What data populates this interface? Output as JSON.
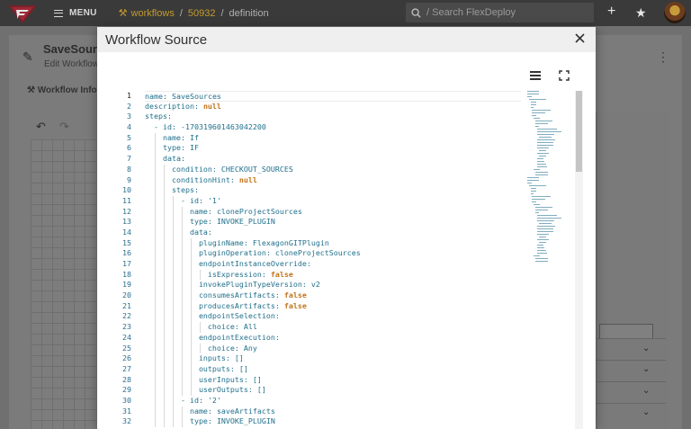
{
  "topbar": {
    "menu_label": "MENU",
    "breadcrumb": [
      "workflows",
      "50932",
      "definition"
    ],
    "breadcrumb_sep": "/",
    "search_placeholder": "/ Search FlexDeploy"
  },
  "background": {
    "title": "SaveSourc",
    "subtitle": "Edit Workflow",
    "tab": "Workflow Info"
  },
  "modal": {
    "title": "Workflow Source",
    "code_lines": [
      [
        [
          "k",
          "name: "
        ],
        [
          "v",
          "SaveSources"
        ]
      ],
      [
        [
          "k",
          "description: "
        ],
        [
          "kw",
          "null"
        ]
      ],
      [
        [
          "k",
          "steps:"
        ]
      ],
      [
        [
          "k",
          "  - id: "
        ],
        [
          "v",
          "-170319601463042200"
        ]
      ],
      [
        [
          "k",
          "    name: "
        ],
        [
          "v",
          "If"
        ]
      ],
      [
        [
          "k",
          "    type: "
        ],
        [
          "v",
          "IF"
        ]
      ],
      [
        [
          "k",
          "    data:"
        ]
      ],
      [
        [
          "k",
          "      condition: "
        ],
        [
          "v",
          "CHECKOUT_SOURCES"
        ]
      ],
      [
        [
          "k",
          "      conditionHint: "
        ],
        [
          "kw",
          "null"
        ]
      ],
      [
        [
          "k",
          "      steps:"
        ]
      ],
      [
        [
          "k",
          "        - id: "
        ],
        [
          "s",
          "'1'"
        ]
      ],
      [
        [
          "k",
          "          name: "
        ],
        [
          "v",
          "cloneProjectSources"
        ]
      ],
      [
        [
          "k",
          "          type: "
        ],
        [
          "v",
          "INVOKE_PLUGIN"
        ]
      ],
      [
        [
          "k",
          "          data:"
        ]
      ],
      [
        [
          "k",
          "            pluginName: "
        ],
        [
          "v",
          "FlexagonGITPlugin"
        ]
      ],
      [
        [
          "k",
          "            pluginOperation: "
        ],
        [
          "v",
          "cloneProjectSources"
        ]
      ],
      [
        [
          "k",
          "            endpointInstanceOverride:"
        ]
      ],
      [
        [
          "k",
          "              isExpression: "
        ],
        [
          "kw",
          "false"
        ]
      ],
      [
        [
          "k",
          "            invokePluginTypeVersion: "
        ],
        [
          "v",
          "v2"
        ]
      ],
      [
        [
          "k",
          "            consumesArtifacts: "
        ],
        [
          "kw",
          "false"
        ]
      ],
      [
        [
          "k",
          "            producesArtifacts: "
        ],
        [
          "kw",
          "false"
        ]
      ],
      [
        [
          "k",
          "            endpointSelection:"
        ]
      ],
      [
        [
          "k",
          "              choice: "
        ],
        [
          "v",
          "All"
        ]
      ],
      [
        [
          "k",
          "            endpointExecution:"
        ]
      ],
      [
        [
          "k",
          "              choice: "
        ],
        [
          "v",
          "Any"
        ]
      ],
      [
        [
          "k",
          "            inputs: "
        ],
        [
          "v",
          "[]"
        ]
      ],
      [
        [
          "k",
          "            outputs: "
        ],
        [
          "v",
          "[]"
        ]
      ],
      [
        [
          "k",
          "            userInputs: "
        ],
        [
          "v",
          "[]"
        ]
      ],
      [
        [
          "k",
          "            userOutputs: "
        ],
        [
          "v",
          "[]"
        ]
      ],
      [
        [
          "k",
          "        - id: "
        ],
        [
          "s",
          "'2'"
        ]
      ],
      [
        [
          "k",
          "          name: "
        ],
        [
          "v",
          "saveArtifacts"
        ]
      ],
      [
        [
          "k",
          "          type: "
        ],
        [
          "v",
          "INVOKE_PLUGIN"
        ]
      ]
    ]
  },
  "icons": [
    "menu-icon",
    "wrench-icon",
    "search-icon",
    "plus-icon",
    "star-icon",
    "close-icon",
    "list-icon",
    "fullscreen-icon"
  ],
  "colors": {
    "topbar": "#3a3a3a",
    "accent": "#c49a2c",
    "code_key": "#1f6f8b",
    "code_literal": "#c1741b"
  }
}
